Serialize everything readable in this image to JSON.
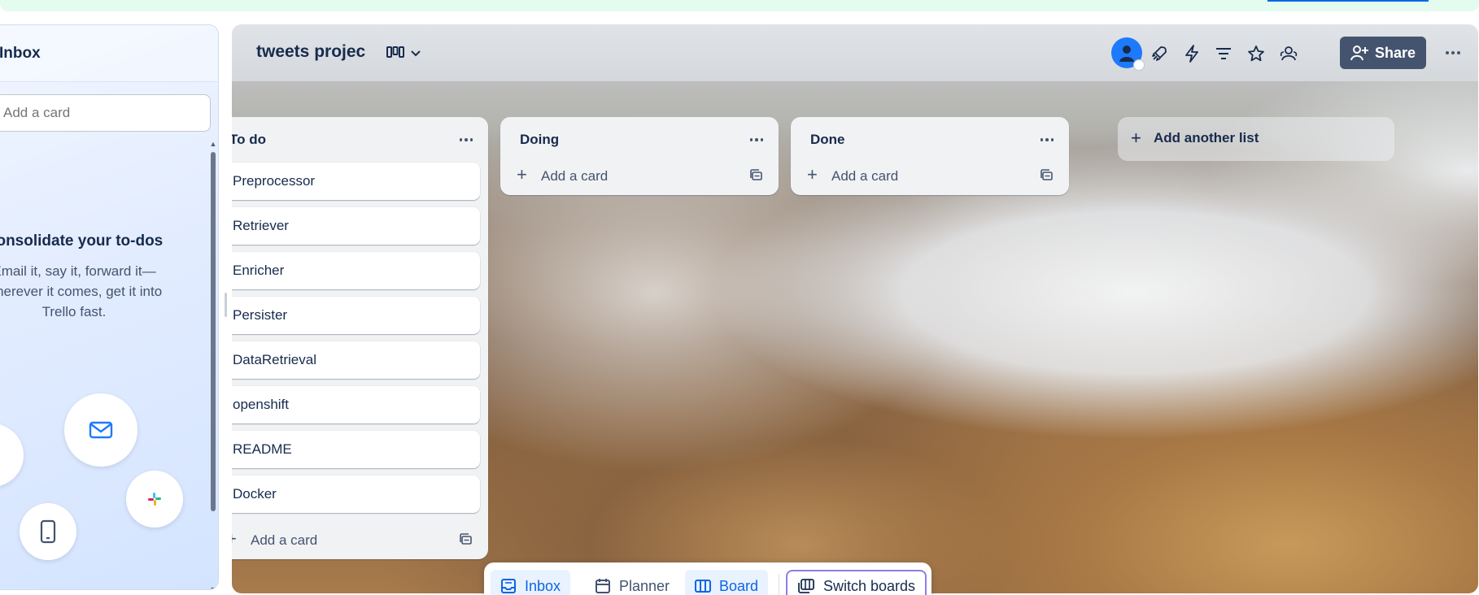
{
  "inbox": {
    "title": "Inbox",
    "add_card_placeholder": "Add a card",
    "heading": "Consolidate your to-dos",
    "body": "Email it, say it, forward it—wherever it comes, get it into Trello fast."
  },
  "board": {
    "title": "tweets projec",
    "share_label": "Share",
    "lists": [
      {
        "title": "To do",
        "cards": [
          "Preprocessor",
          "Retriever",
          "Enricher",
          "Persister",
          "DataRetrieval",
          "openshift",
          "README",
          "Docker"
        ],
        "add_card_label": "Add a card"
      },
      {
        "title": "Doing",
        "cards": [],
        "add_card_label": "Add a card"
      },
      {
        "title": "Done",
        "cards": [],
        "add_card_label": "Add a card"
      }
    ],
    "add_list_label": "Add another list"
  },
  "bottom_nav": {
    "inbox": "Inbox",
    "planner": "Planner",
    "board": "Board",
    "switch_boards": "Switch boards"
  },
  "colors": {
    "accent": "#0c66e4",
    "share_bg": "#44546f",
    "list_bg": "#f1f2f4",
    "switch_border": "#8f7ee7"
  }
}
